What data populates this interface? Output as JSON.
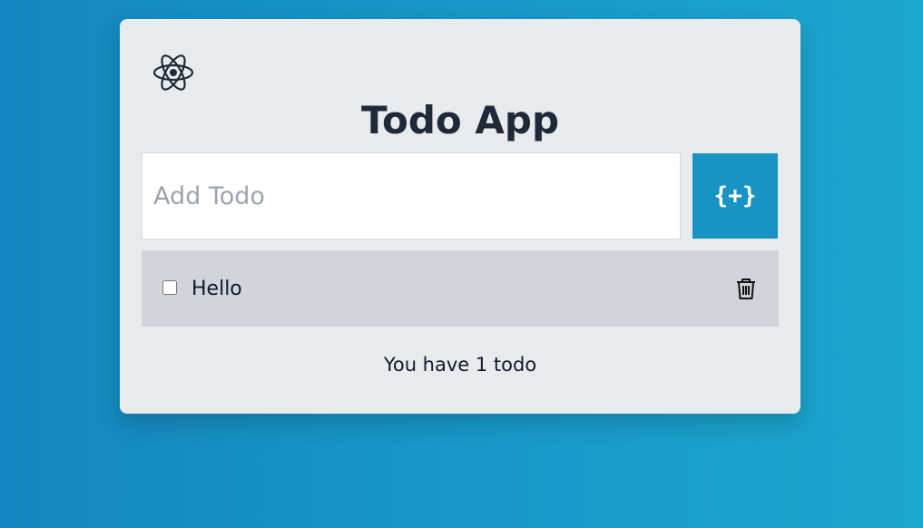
{
  "app": {
    "title": "Todo App",
    "logo_icon": "react-atom-icon"
  },
  "input": {
    "placeholder": "Add Todo",
    "value": ""
  },
  "add_button": {
    "label": "{+}"
  },
  "todos": [
    {
      "text": "Hello",
      "completed": false,
      "delete_icon": "trash-icon"
    }
  ],
  "footer": {
    "count_text": "You have 1 todo"
  },
  "colors": {
    "accent": "#1893c4",
    "card_bg": "#e8ebee",
    "item_bg": "#d1d5db",
    "title": "#1f2937"
  }
}
